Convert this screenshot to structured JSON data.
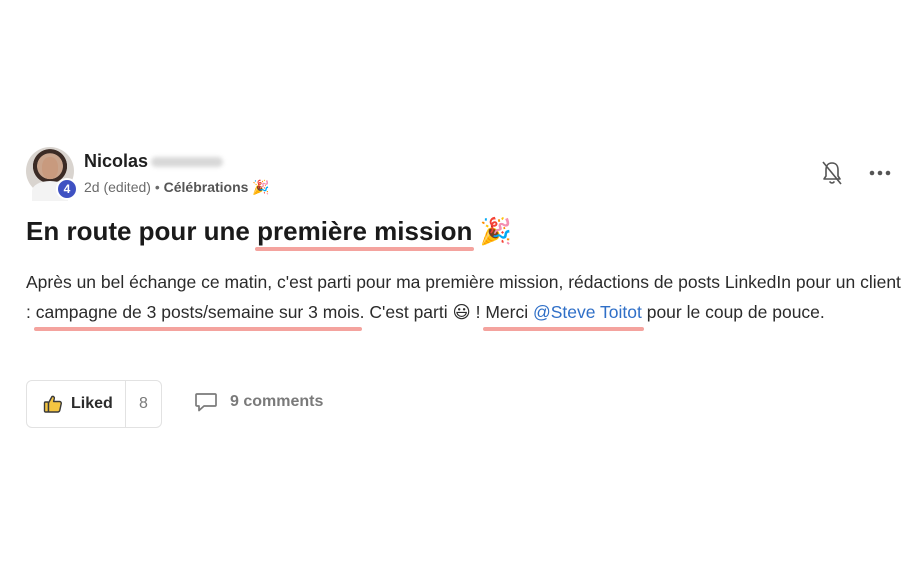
{
  "post": {
    "author": {
      "name": "Nicolas",
      "level": "4"
    },
    "meta": {
      "time": "2d (edited)",
      "separator": "•",
      "category": "Célébrations",
      "category_emoji": "🎉"
    },
    "title": {
      "before": "En route pour une ",
      "highlight": "première mission",
      "emoji": "🎉"
    },
    "body": {
      "part1": "Après un bel échange ce matin, c'est parti pour ma première mission, rédactions de posts LinkedIn pour un client : ",
      "highlight1": "campagne de 3 posts/semaine sur 3 mois",
      "part2": ". C'est parti ",
      "emoji": "😃",
      "part3": " ! ",
      "highlight2_text": "Merci ",
      "mention": "@Steve Toitot",
      "part4": " pour le coup de pouce."
    },
    "actions": {
      "like_label": "Liked",
      "like_count": "8",
      "comments_label": "9 comments"
    },
    "icons": {
      "bell": "bell-off-icon",
      "more": "more-horizontal-icon",
      "like": "thumbs-up-icon",
      "comment": "comment-icon"
    },
    "colors": {
      "highlight": "#f4a39e",
      "mention": "#2f6fc7",
      "badge": "#3f51c2"
    }
  }
}
